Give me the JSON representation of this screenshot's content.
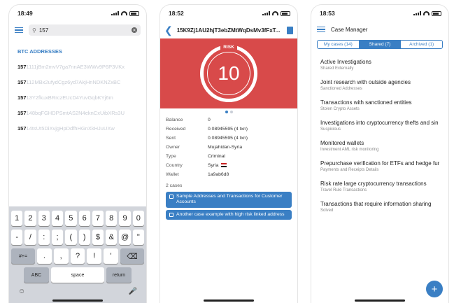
{
  "screen1": {
    "time": "18:49",
    "search_value": "157",
    "section_title": "BTC ADDRESSES",
    "prefix": "157",
    "addresses": [
      "1111jBm2mvV7ga7nnAE3WWv9P6P3VKx",
      "112MBx2ufydCgz6yd7AkjHnNDKNZxBC",
      "13Y2fkuxBRrczEUcD4YuvGqbKYj6m",
      "148bqFGHDPSmtAS2N4eknCxUibXRs3U",
      "14tsUt5DiXvjgHpDdfhHGnXkHJuUXw"
    ],
    "keyboard": {
      "row1": [
        "1",
        "2",
        "3",
        "4",
        "5",
        "6",
        "7",
        "8",
        "9",
        "0"
      ],
      "row2": [
        "-",
        "/",
        ":",
        ";",
        "(",
        ")",
        "$",
        "&",
        "@",
        "\""
      ],
      "shift_label": "#+=",
      "row3": [
        ".",
        ",",
        "?",
        "!",
        "'"
      ],
      "abc_label": "ABC",
      "space_label": "space",
      "return_label": "return"
    }
  },
  "screen2": {
    "time": "18:52",
    "title": "15K9Zj1AU2hjT3ebZMtWqDsMv3fFxT...",
    "risk_label": "RISK",
    "risk_score": "10",
    "details": [
      {
        "k": "Balance",
        "v": "0"
      },
      {
        "k": "Received",
        "v": "0.08945595 (4 txn)"
      },
      {
        "k": "Sent",
        "v": "0.08945595 (4 txn)"
      },
      {
        "k": "Owner",
        "v": "Mujahidan-Syria"
      },
      {
        "k": "Type",
        "v": "Criminal"
      },
      {
        "k": "Country",
        "v": "Syria"
      },
      {
        "k": "Wallet",
        "v": "1a9ab6d8"
      }
    ],
    "cases_label": "2 cases",
    "cases": [
      "Sample Addresses and Transactions for Customer Accounts",
      "Another case example with high risk linked address"
    ]
  },
  "screen3": {
    "time": "18:53",
    "title": "Case Manager",
    "tabs": [
      "My cases (14)",
      "Shared (7)",
      "Archived (1)"
    ],
    "items": [
      {
        "t": "Active Investigations",
        "s": "Shared Externally"
      },
      {
        "t": "Joint research with outside agencies",
        "s": "Sanctioned Addresses"
      },
      {
        "t": "Transactions with sanctioned entities",
        "s": "Stolen Crypto Assets"
      },
      {
        "t": "Investigations into cryptocurrency thefts and sin",
        "s": "Suspicious"
      },
      {
        "t": "Monitored wallets",
        "s": "Investment AML risk monitoring"
      },
      {
        "t": "Prepurchase verification for ETFs and hedge fur",
        "s": "Payments and Receipts Details"
      },
      {
        "t": "Risk rate large cryptocurrency transactions",
        "s": "Travel Rule Transactions"
      },
      {
        "t": "Transactions that require information sharing",
        "s": "Solved"
      }
    ],
    "fab_label": "+"
  }
}
